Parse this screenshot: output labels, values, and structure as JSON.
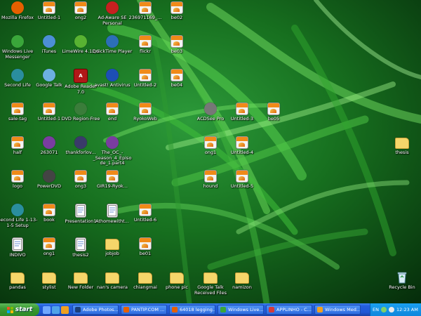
{
  "desktop": {
    "icons": [
      {
        "label": "Mozilla Firefox",
        "icon": "firefox-icon",
        "kind": "round",
        "color": "#e66000"
      },
      {
        "label": "Untitled-1",
        "icon": "jpg-file-icon",
        "kind": "jpg"
      },
      {
        "label": "ong2",
        "icon": "jpg-file-icon",
        "kind": "jpg"
      },
      {
        "label": "Ad-Aware SE Personal",
        "icon": "ad-aware-icon",
        "kind": "round",
        "color": "#c62020"
      },
      {
        "label": "236971169_...",
        "icon": "jpg-file-icon",
        "kind": "jpg"
      },
      {
        "label": "be02",
        "icon": "jpg-file-icon",
        "kind": "jpg"
      },
      {
        "label": "Windows Live Messenger",
        "icon": "messenger-icon",
        "kind": "round",
        "color": "#3aa63a"
      },
      {
        "label": "iTunes",
        "icon": "itunes-icon",
        "kind": "round",
        "color": "#4c8fd6"
      },
      {
        "label": "LimeWire 4.12.6",
        "icon": "limewire-icon",
        "kind": "round",
        "color": "#58b332"
      },
      {
        "label": "QuickTime Player",
        "icon": "quicktime-icon",
        "kind": "round",
        "color": "#2c6fb8"
      },
      {
        "label": "flickr",
        "icon": "jpg-file-icon",
        "kind": "jpg"
      },
      {
        "label": "be03",
        "icon": "jpg-file-icon",
        "kind": "jpg"
      },
      {
        "label": "Second Life",
        "icon": "second-life-icon",
        "kind": "round",
        "color": "#2a8e9e"
      },
      {
        "label": "Google Talk",
        "icon": "google-talk-icon",
        "kind": "round",
        "color": "#6cb0e0"
      },
      {
        "label": "Adobe Reader 7.0",
        "icon": "pdf-icon",
        "kind": "pdf"
      },
      {
        "label": "avast! Antivirus",
        "icon": "avast-icon",
        "kind": "round",
        "color": "#1d4fb5"
      },
      {
        "label": "Untitled-2",
        "icon": "jpg-file-icon",
        "kind": "jpg"
      },
      {
        "label": "be04",
        "icon": "jpg-file-icon",
        "kind": "jpg"
      },
      {
        "label": "sale-tag",
        "icon": "jpg-file-icon",
        "kind": "jpg"
      },
      {
        "label": "Untitled-1",
        "icon": "jpg-file-icon",
        "kind": "jpg"
      },
      {
        "label": "DVD Region-Free",
        "icon": "dvd-region-icon",
        "kind": "round",
        "color": "#3a7d3a"
      },
      {
        "label": "end",
        "icon": "jpg-file-icon",
        "kind": "jpg"
      },
      {
        "label": "RyokoWeb",
        "icon": "bmp-file-icon",
        "kind": "jpg"
      },
      {
        "label": "ACDSee Pro",
        "icon": "acdsee-icon",
        "kind": "round",
        "color": "#777"
      },
      {
        "label": "Untitled-3",
        "icon": "jpg-file-icon",
        "kind": "jpg"
      },
      {
        "label": "be05",
        "icon": "jpg-file-icon",
        "kind": "jpg"
      },
      {
        "label": "half",
        "icon": "jpg-file-icon",
        "kind": "jpg"
      },
      {
        "label": "263071",
        "icon": "winrar-icon",
        "kind": "round",
        "color": "#7a3da0"
      },
      {
        "label": "thankforlov...",
        "icon": "media-file-icon",
        "kind": "round",
        "color": "#3a3a6a"
      },
      {
        "label": "The_OC_-_Season_4_Episode_1.part4",
        "icon": "winrar-icon",
        "kind": "round",
        "color": "#7a3da0"
      },
      {
        "label": "ong1",
        "icon": "jpg-file-icon",
        "kind": "jpg"
      },
      {
        "label": "Untitled-4",
        "icon": "jpg-file-icon",
        "kind": "jpg"
      },
      {
        "label": "thesis",
        "icon": "folder-icon",
        "kind": "folder"
      },
      {
        "label": "logo",
        "icon": "jpg-file-icon",
        "kind": "jpg"
      },
      {
        "label": "PowerDVD",
        "icon": "powerdvd-icon",
        "kind": "round",
        "color": "#444"
      },
      {
        "label": "ong3",
        "icon": "jpg-file-icon",
        "kind": "jpg"
      },
      {
        "label": "GIR19-Ryok...",
        "icon": "jpg-file-icon",
        "kind": "jpg"
      },
      {
        "label": "hound",
        "icon": "jpg-file-icon",
        "kind": "jpg"
      },
      {
        "label": "Untitled-5",
        "icon": "jpg-file-icon",
        "kind": "jpg"
      },
      {
        "label": "Second Life 1-13-1-5 Setup",
        "icon": "second-life-setup-icon",
        "kind": "round",
        "color": "#2a8e9e"
      },
      {
        "label": "book",
        "icon": "jpg-file-icon",
        "kind": "jpg"
      },
      {
        "label": "Presentation1",
        "icon": "powerpoint-icon",
        "kind": "doc"
      },
      {
        "label": "Athomewitht...",
        "icon": "document-icon",
        "kind": "doc"
      },
      {
        "label": "Untitled-6",
        "icon": "jpg-file-icon",
        "kind": "jpg"
      },
      {
        "label": "INDIVO",
        "icon": "word-doc-icon",
        "kind": "doc"
      },
      {
        "label": "ong1",
        "icon": "jpg-file-icon",
        "kind": "jpg"
      },
      {
        "label": "thesis2",
        "icon": "document-icon",
        "kind": "doc"
      },
      {
        "label": "jobjob",
        "icon": "folder-icon",
        "kind": "folder"
      },
      {
        "label": "be01",
        "icon": "jpg-file-icon",
        "kind": "jpg"
      },
      {
        "label": "pandas",
        "icon": "folder-icon",
        "kind": "folder"
      },
      {
        "label": "stylist",
        "icon": "folder-icon",
        "kind": "folder"
      },
      {
        "label": "New Folder",
        "icon": "folder-icon",
        "kind": "folder"
      },
      {
        "label": "nan's camera",
        "icon": "folder-icon",
        "kind": "folder"
      },
      {
        "label": "chiangmai",
        "icon": "folder-icon",
        "kind": "folder"
      },
      {
        "label": "phone pic",
        "icon": "folder-icon",
        "kind": "folder"
      },
      {
        "label": "Google Talk Received Files",
        "icon": "folder-icon",
        "kind": "folder"
      },
      {
        "label": "namizon",
        "icon": "folder-icon",
        "kind": "folder"
      },
      {
        "label": "Recycle Bin",
        "icon": "recycle-bin-icon",
        "kind": "recycle"
      }
    ]
  },
  "taskbar": {
    "start_label": "start",
    "quick_launch": [
      {
        "icon": "show-desktop-icon",
        "color": "#6fa8ff"
      },
      {
        "icon": "internet-explorer-icon",
        "color": "#4fa3e8"
      },
      {
        "icon": "media-player-icon",
        "color": "#f0a020"
      }
    ],
    "tasks": [
      {
        "label": "Adobe Photos...",
        "icon": "photoshop-icon",
        "color": "#1b3f7a"
      },
      {
        "label": "PANTIP.COM ...",
        "icon": "firefox-icon",
        "color": "#e66000"
      },
      {
        "label": "64018 legging...",
        "icon": "firefox-icon",
        "color": "#e66000"
      },
      {
        "label": "Windows Live...",
        "icon": "messenger-icon",
        "color": "#3aa63a"
      },
      {
        "label": "APPLINHO - C...",
        "icon": "chat-icon",
        "color": "#d43a3a"
      },
      {
        "label": "Windows Med...",
        "icon": "media-player-icon",
        "color": "#f0a020"
      }
    ],
    "tray": {
      "language": "EN",
      "clock": "12:23 AM"
    }
  }
}
